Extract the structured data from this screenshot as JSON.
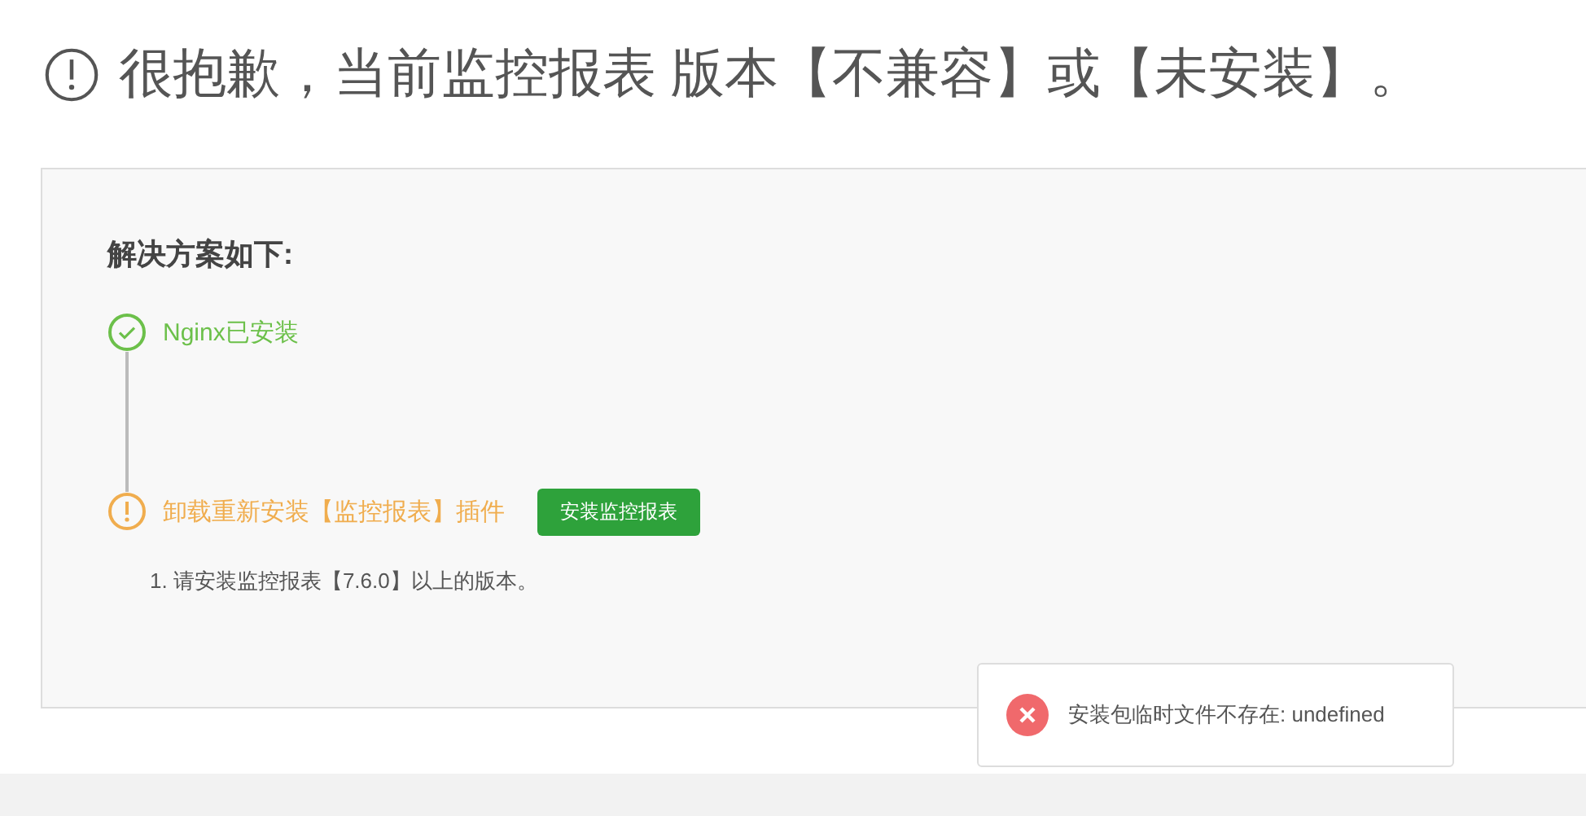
{
  "heading": "很抱歉，当前监控报表 版本【不兼容】或【未安装】。",
  "panel": {
    "title": "解决方案如下:",
    "steps": [
      {
        "kind": "done",
        "label": "Nginx已安装"
      },
      {
        "kind": "warning",
        "label": "卸载重新安装【监控报表】插件",
        "button": "安装监控报表",
        "notes": [
          "1. 请安装监控报表【7.6.0】以上的版本。"
        ]
      }
    ]
  },
  "toast": {
    "kind": "error",
    "message": "安装包临时文件不存在: undefined"
  }
}
